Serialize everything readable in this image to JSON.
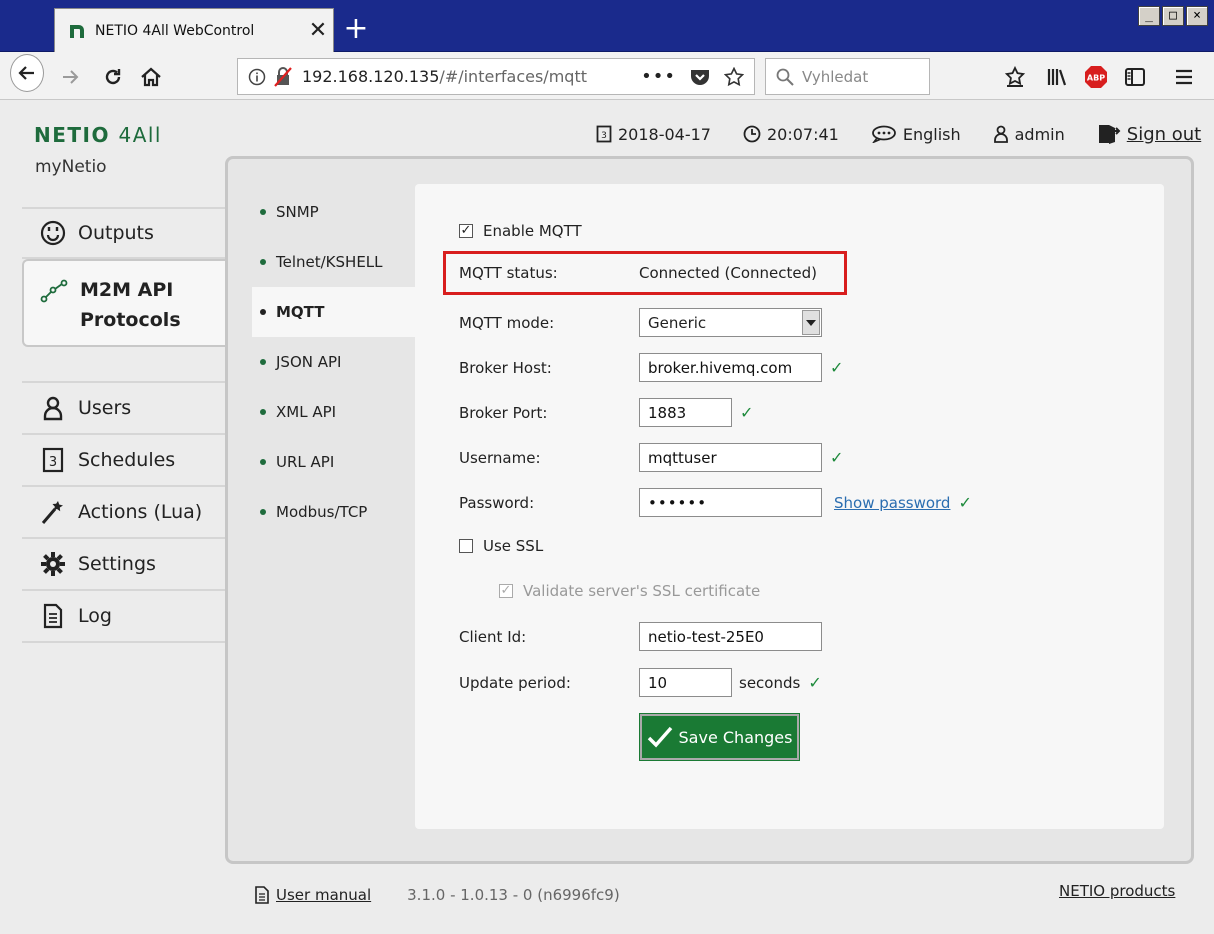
{
  "browser": {
    "tab_title": "NETIO 4All WebControl",
    "url_main": "192.168.120.135",
    "url_path": "/#/interfaces/mqtt",
    "search_placeholder": "Vyhledat",
    "new_tab": "+"
  },
  "header": {
    "brand_bold": "NETIO",
    "brand_light": "4All",
    "device_name": "myNetio",
    "date": "2018-04-17",
    "time": "20:07:41",
    "language": "English",
    "user": "admin",
    "sign_out": "Sign out"
  },
  "sidebar": {
    "items": [
      {
        "label": "Outputs",
        "icon": "outlet-icon"
      },
      {
        "label": "M2M API",
        "label2": "Protocols",
        "icon": "m2m-icon"
      },
      {
        "label": "Users",
        "icon": "user-icon"
      },
      {
        "label": "Schedules",
        "icon": "calendar-icon"
      },
      {
        "label": "Actions (Lua)",
        "icon": "wand-icon"
      },
      {
        "label": "Settings",
        "icon": "gear-icon"
      },
      {
        "label": "Log",
        "icon": "document-icon"
      }
    ]
  },
  "subnav": {
    "items": [
      "SNMP",
      "Telnet/KSHELL",
      "MQTT",
      "JSON API",
      "XML API",
      "URL API",
      "Modbus/TCP"
    ]
  },
  "form": {
    "enable_label": "Enable MQTT",
    "status_label": "MQTT status:",
    "status_value": "Connected (Connected)",
    "mode_label": "MQTT mode:",
    "mode_value": "Generic",
    "host_label": "Broker Host:",
    "host_value": "broker.hivemq.com",
    "port_label": "Broker Port:",
    "port_value": "1883",
    "user_label": "Username:",
    "user_value": "mqttuser",
    "pass_label": "Password:",
    "pass_value": "••••••",
    "show_password": "Show password",
    "ssl_label": "Use SSL",
    "validate_label": "Validate server's SSL certificate",
    "client_label": "Client Id:",
    "client_value": "netio-test-25E0",
    "period_label": "Update period:",
    "period_value": "10",
    "period_unit": "seconds",
    "check": "✓",
    "save_label": "Save Changes"
  },
  "footer": {
    "manual": "User manual",
    "version": "3.1.0 - 1.0.13 - 0 (n6996fc9)",
    "products": "NETIO products"
  },
  "colors": {
    "brand_green": "#1e6b3c",
    "save_green": "#1a7a34",
    "highlight_red": "#d81e1e",
    "link_blue": "#2a6db0"
  }
}
